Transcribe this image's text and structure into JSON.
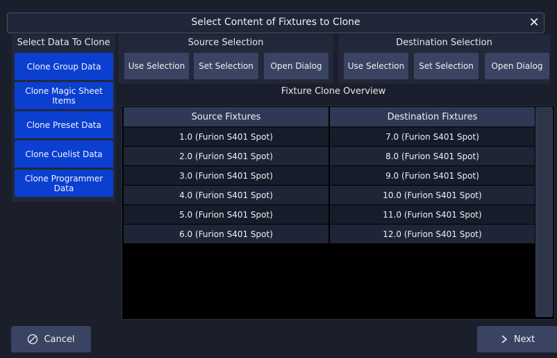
{
  "dialog": {
    "title": "Select Content of Fixtures to Clone",
    "close_label": "✕"
  },
  "left_panel": {
    "heading": "Select Data To Clone",
    "items": [
      "Clone Group Data",
      "Clone Magic Sheet Items",
      "Clone Preset Data",
      "Clone Cuelist Data",
      "Clone Programmer Data"
    ]
  },
  "source_selection": {
    "heading": "Source Selection",
    "buttons": [
      "Use Selection",
      "Set Selection",
      "Open Dialog"
    ]
  },
  "destination_selection": {
    "heading": "Destination Selection",
    "buttons": [
      "Use Selection",
      "Set Selection",
      "Open Dialog"
    ]
  },
  "overview": {
    "heading": "Fixture Clone Overview",
    "columns": [
      "Source Fixtures",
      "Destination Fixtures"
    ],
    "rows": [
      [
        "1.0 (Furion S401 Spot)",
        "7.0 (Furion S401 Spot)"
      ],
      [
        "2.0 (Furion S401 Spot)",
        "8.0 (Furion S401 Spot)"
      ],
      [
        "3.0 (Furion S401 Spot)",
        "9.0 (Furion S401 Spot)"
      ],
      [
        "4.0 (Furion S401 Spot)",
        "10.0 (Furion S401 Spot)"
      ],
      [
        "5.0 (Furion S401 Spot)",
        "11.0 (Furion S401 Spot)"
      ],
      [
        "6.0 (Furion S401 Spot)",
        "12.0 (Furion S401 Spot)"
      ]
    ]
  },
  "footer": {
    "cancel_label": "Cancel",
    "cancel_icon": "cancel-circle-icon",
    "next_label": "Next",
    "next_icon": "chevron-right-icon"
  },
  "colors": {
    "accent": "#0a3fd0",
    "background": "#1b1f2c",
    "button": "#3a4462"
  }
}
